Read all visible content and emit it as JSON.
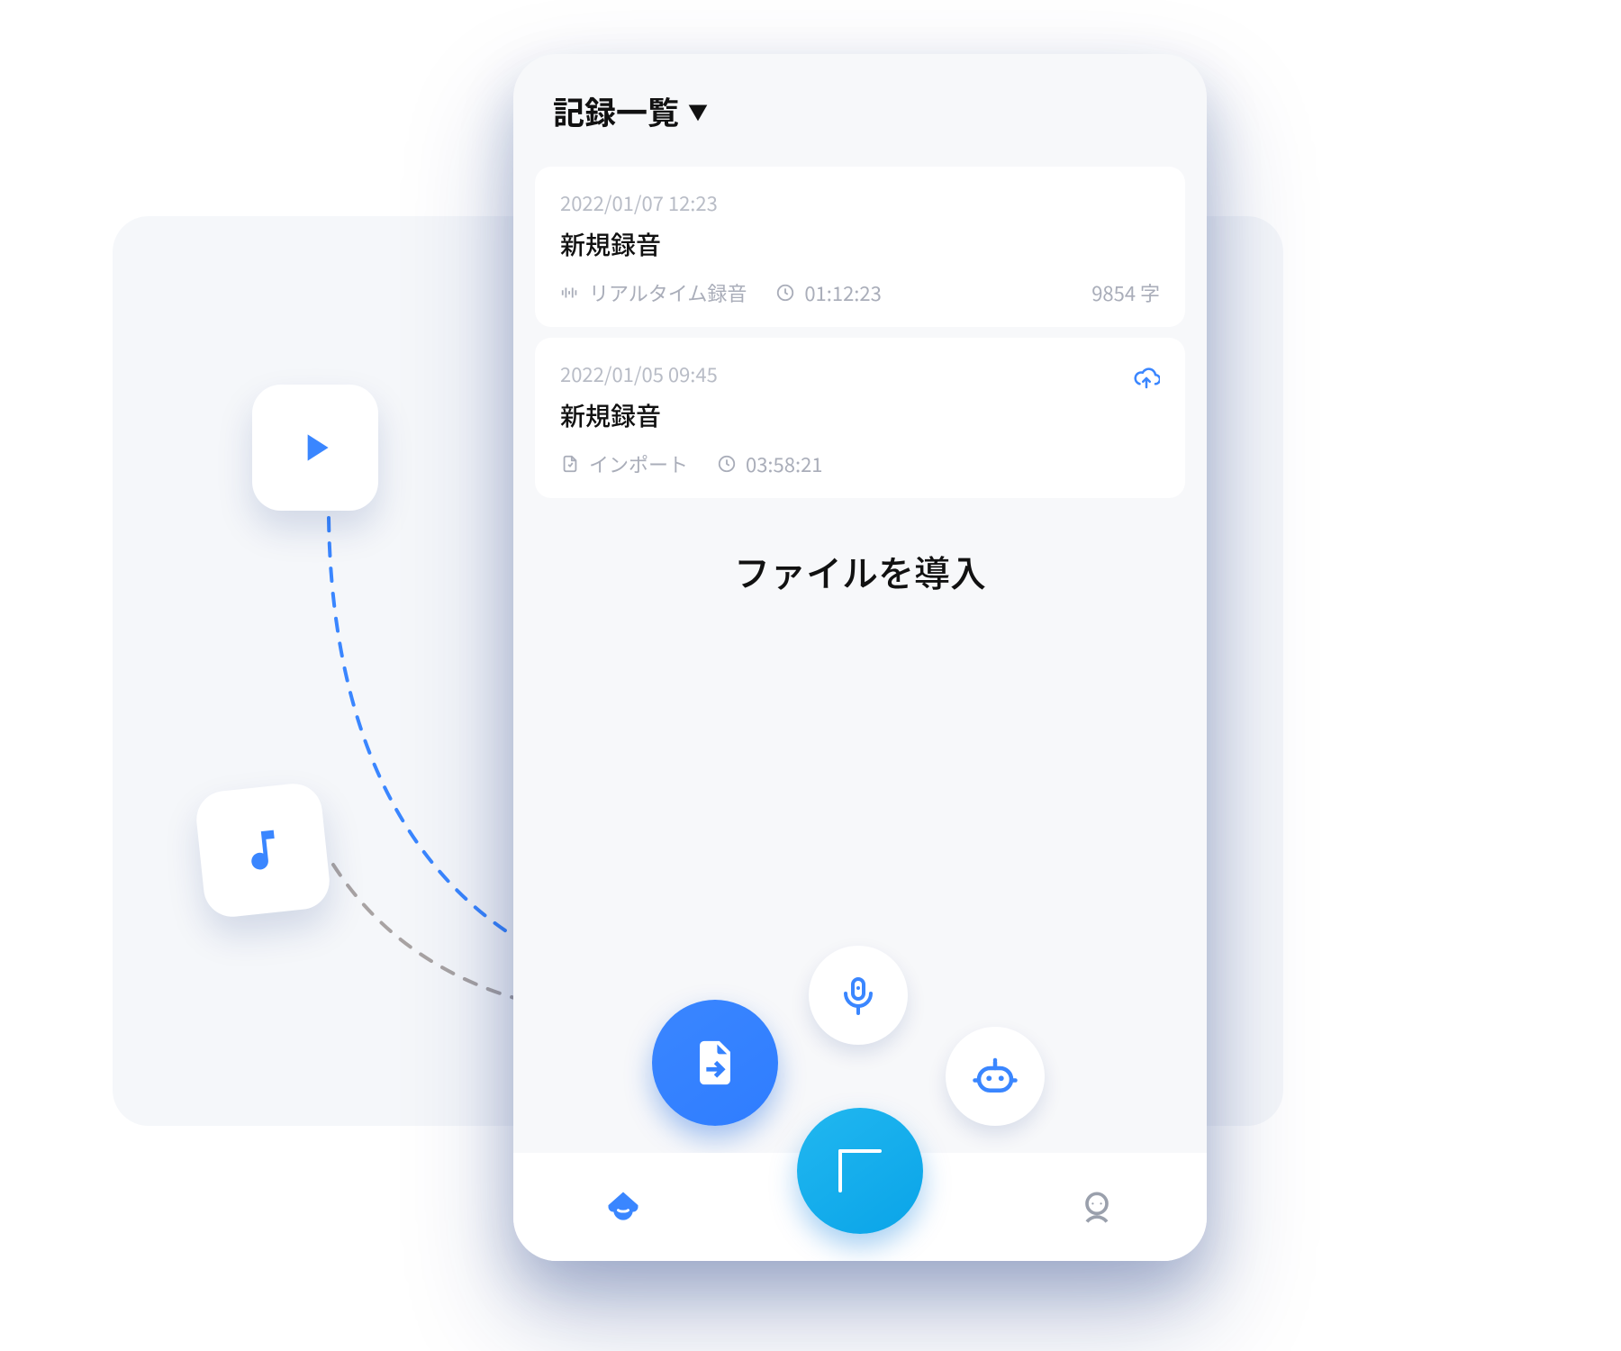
{
  "header": {
    "title": "記録一覧"
  },
  "cards": [
    {
      "date": "2022/01/07 12:23",
      "title": "新規録音",
      "source": "リアルタイム録音",
      "duration": "01:12:23",
      "chars": "9854 字"
    },
    {
      "date": "2022/01/05 09:45",
      "title": "新規録音",
      "source": "インポート",
      "duration": "03:58:21"
    }
  ],
  "section_title": "ファイルを導入",
  "colors": {
    "accent": "#3a86ff",
    "fab": "#0aa4e8",
    "muted": "#a9adb9"
  }
}
